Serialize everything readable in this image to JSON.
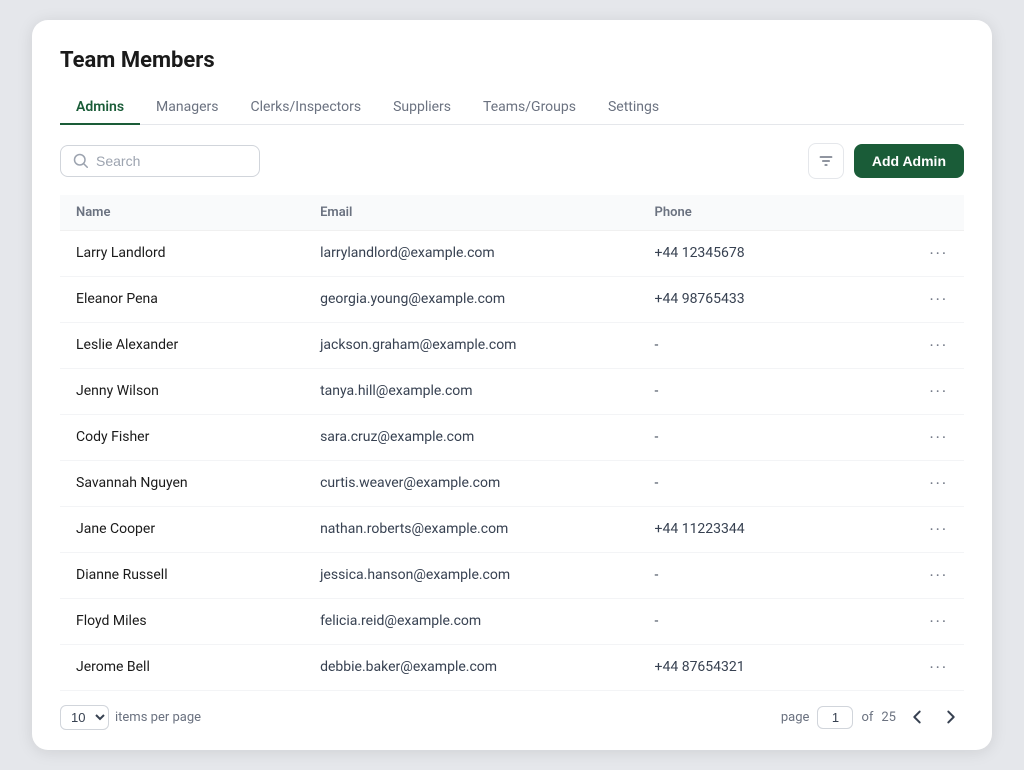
{
  "page": {
    "title": "Team Members"
  },
  "tabs": [
    {
      "id": "admins",
      "label": "Admins",
      "active": true
    },
    {
      "id": "managers",
      "label": "Managers",
      "active": false
    },
    {
      "id": "clerks",
      "label": "Clerks/Inspectors",
      "active": false
    },
    {
      "id": "suppliers",
      "label": "Suppliers",
      "active": false
    },
    {
      "id": "teams",
      "label": "Teams/Groups",
      "active": false
    },
    {
      "id": "settings",
      "label": "Settings",
      "active": false
    }
  ],
  "toolbar": {
    "search_placeholder": "Search",
    "add_button_label": "Add Admin"
  },
  "table": {
    "columns": [
      {
        "id": "name",
        "label": "Name"
      },
      {
        "id": "email",
        "label": "Email"
      },
      {
        "id": "phone",
        "label": "Phone"
      }
    ],
    "rows": [
      {
        "name": "Larry Landlord",
        "email": "larrylandlord@example.com",
        "phone": "+44 12345678"
      },
      {
        "name": "Eleanor Pena",
        "email": "georgia.young@example.com",
        "phone": "+44 98765433"
      },
      {
        "name": "Leslie Alexander",
        "email": "jackson.graham@example.com",
        "phone": "-"
      },
      {
        "name": "Jenny Wilson",
        "email": "tanya.hill@example.com",
        "phone": "-"
      },
      {
        "name": "Cody Fisher",
        "email": "sara.cruz@example.com",
        "phone": "-"
      },
      {
        "name": "Savannah Nguyen",
        "email": "curtis.weaver@example.com",
        "phone": "-"
      },
      {
        "name": "Jane Cooper",
        "email": "nathan.roberts@example.com",
        "phone": "+44 11223344"
      },
      {
        "name": "Dianne Russell",
        "email": "jessica.hanson@example.com",
        "phone": "-"
      },
      {
        "name": "Floyd Miles",
        "email": "felicia.reid@example.com",
        "phone": "-"
      },
      {
        "name": "Jerome Bell",
        "email": "debbie.baker@example.com",
        "phone": "+44 87654321"
      }
    ]
  },
  "pagination": {
    "items_per_page": "10",
    "items_per_page_label": "items per page",
    "page_label": "page",
    "current_page": "1",
    "total_pages": "25",
    "of_label": "of"
  },
  "colors": {
    "accent": "#1a5c38"
  }
}
